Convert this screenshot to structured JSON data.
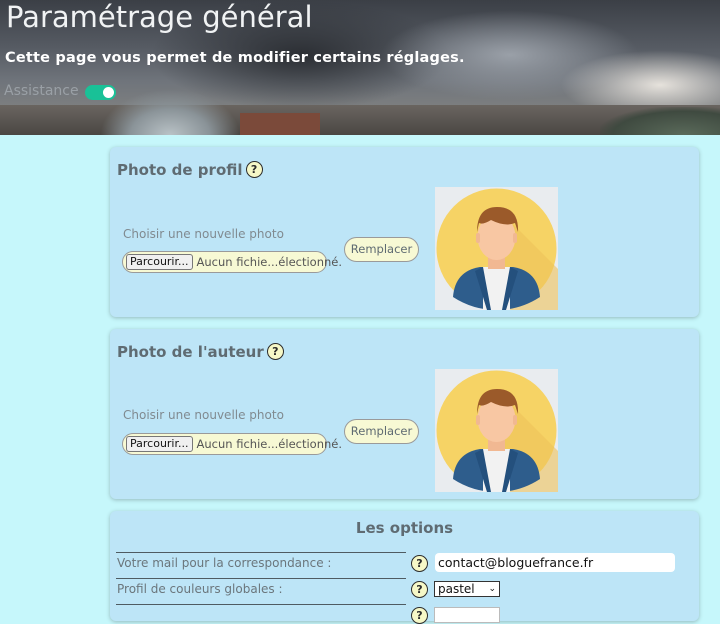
{
  "header": {
    "title": "Paramétrage général",
    "subtitle": "Cette page vous permet de modifier certains réglages.",
    "assistance_label": "Assistance",
    "assistance_on": true
  },
  "profile_photo": {
    "title": "Photo de profil",
    "help": "?",
    "choose_label": "Choisir une nouvelle photo",
    "browse_label": "Parcourir...",
    "file_status": "Aucun fichie...électionné.",
    "replace_label": "Remplacer"
  },
  "author_photo": {
    "title": "Photo de l'auteur",
    "help": "?",
    "choose_label": "Choisir une nouvelle photo",
    "browse_label": "Parcourir...",
    "file_status": "Aucun fichie...électionné.",
    "replace_label": "Remplacer"
  },
  "options": {
    "title": "Les options",
    "mail_label": "Votre mail pour la correspondance :",
    "mail_value": "contact@bloguefrance.fr",
    "color_label": "Profil de couleurs globales :",
    "color_value": "pastel",
    "help": "?"
  },
  "colors": {
    "page_bg": "#c6f7fb",
    "card_bg": "#bde5f7",
    "toggle_on": "#19c197",
    "button_bg": "#f7f9d4"
  }
}
